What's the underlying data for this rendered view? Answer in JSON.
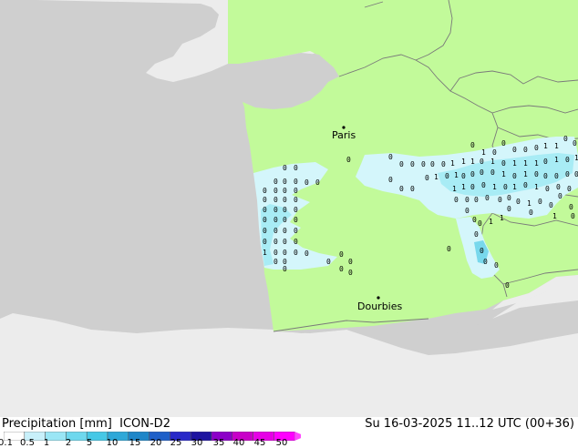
{
  "title": {
    "variable": "Precipitation [mm]",
    "model": "ICON-D2",
    "valid_time": "Su 16-03-2025 11..12 UTC (00+36)"
  },
  "cities": [
    {
      "name": "Paris"
    },
    {
      "name": "Dourbies"
    }
  ],
  "colorbar": {
    "ticks": [
      "0.1",
      "0.5",
      "1",
      "2",
      "5",
      "10",
      "15",
      "20",
      "25",
      "30",
      "35",
      "40",
      "45",
      "50"
    ],
    "colors": [
      "#ffffff",
      "#c8f0fa",
      "#9ae6f5",
      "#6ed8ee",
      "#46c8e6",
      "#2fa8d8",
      "#1e86c8",
      "#1e5fc8",
      "#2828c8",
      "#1e14a0",
      "#8c00c8",
      "#c800c8",
      "#e600e6",
      "#ff00ff",
      "#ff46ff"
    ]
  },
  "colors": {
    "ocean": "#cfcfcf",
    "land_outside": "#ececec",
    "domain_land": "#c2fa9a",
    "border": "#7a7a7a",
    "precip_light": "#d4f6fb",
    "precip_mid": "#a8ecf5",
    "precip_strong": "#78d8ec"
  },
  "precip_values": [
    "0",
    "1"
  ]
}
